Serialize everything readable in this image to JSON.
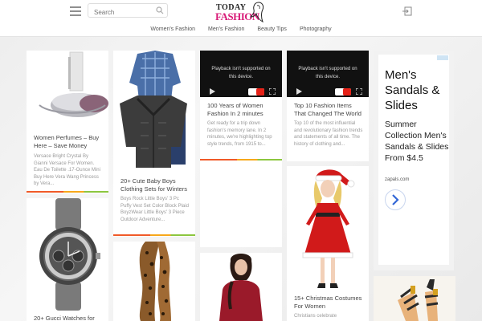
{
  "header": {
    "search_placeholder": "Search",
    "logo_line1": "TODAY",
    "logo_line2": "FASHION"
  },
  "nav": [
    "Women's Fashion",
    "Men's Fashion",
    "Beauty Tips",
    "Photography"
  ],
  "video": {
    "message_line1": "Playback isn't supported on",
    "message_line2": "this device."
  },
  "cards": [
    {
      "title": "Women Perfumes – Buy Here – Save Money",
      "desc": "Versace Bright Crystal By Gianni Versace For Women. Eau De Toilette .17-Ounce Mini Buy Here Vera Wang Princess by Vera..."
    },
    {
      "title": "20+ Gucci Watches for"
    },
    {
      "title": "20+ Cute Baby Boys Clothing Sets for Winters",
      "desc": "Boys Rock Little Boys' 3 Pc Puffy Vest Set Color Block Plaid  BoyzWear Little Boys' 3 Piece Outdoor Adventure..."
    },
    {
      "title": "100 Years of Women Fashion In 2 minutes",
      "desc": "Get ready for a trip down fashion's memory lane. In 2 minutes, we're highlighting top style trends, from 1915 to..."
    },
    {
      "title": "Top 10 Fashion Items That Changed The World",
      "desc": "Top 10 of the most influential and revolutionary fashion trends and statements of all time. The history of clothing and..."
    },
    {
      "title": "15+ Christmas Costumes For Women",
      "desc": "Christians celebrate"
    }
  ],
  "ad": {
    "headline": "Men's Sandals & Slides",
    "body": "Summer Collection Men's Sandals & Slides From $4.5",
    "url": "zapals.com"
  },
  "colors": {
    "accent": "#d81b78",
    "bar_orange": "#f05a28",
    "bar_yellow": "#f7a81b",
    "bar_green": "#8cc63f"
  }
}
